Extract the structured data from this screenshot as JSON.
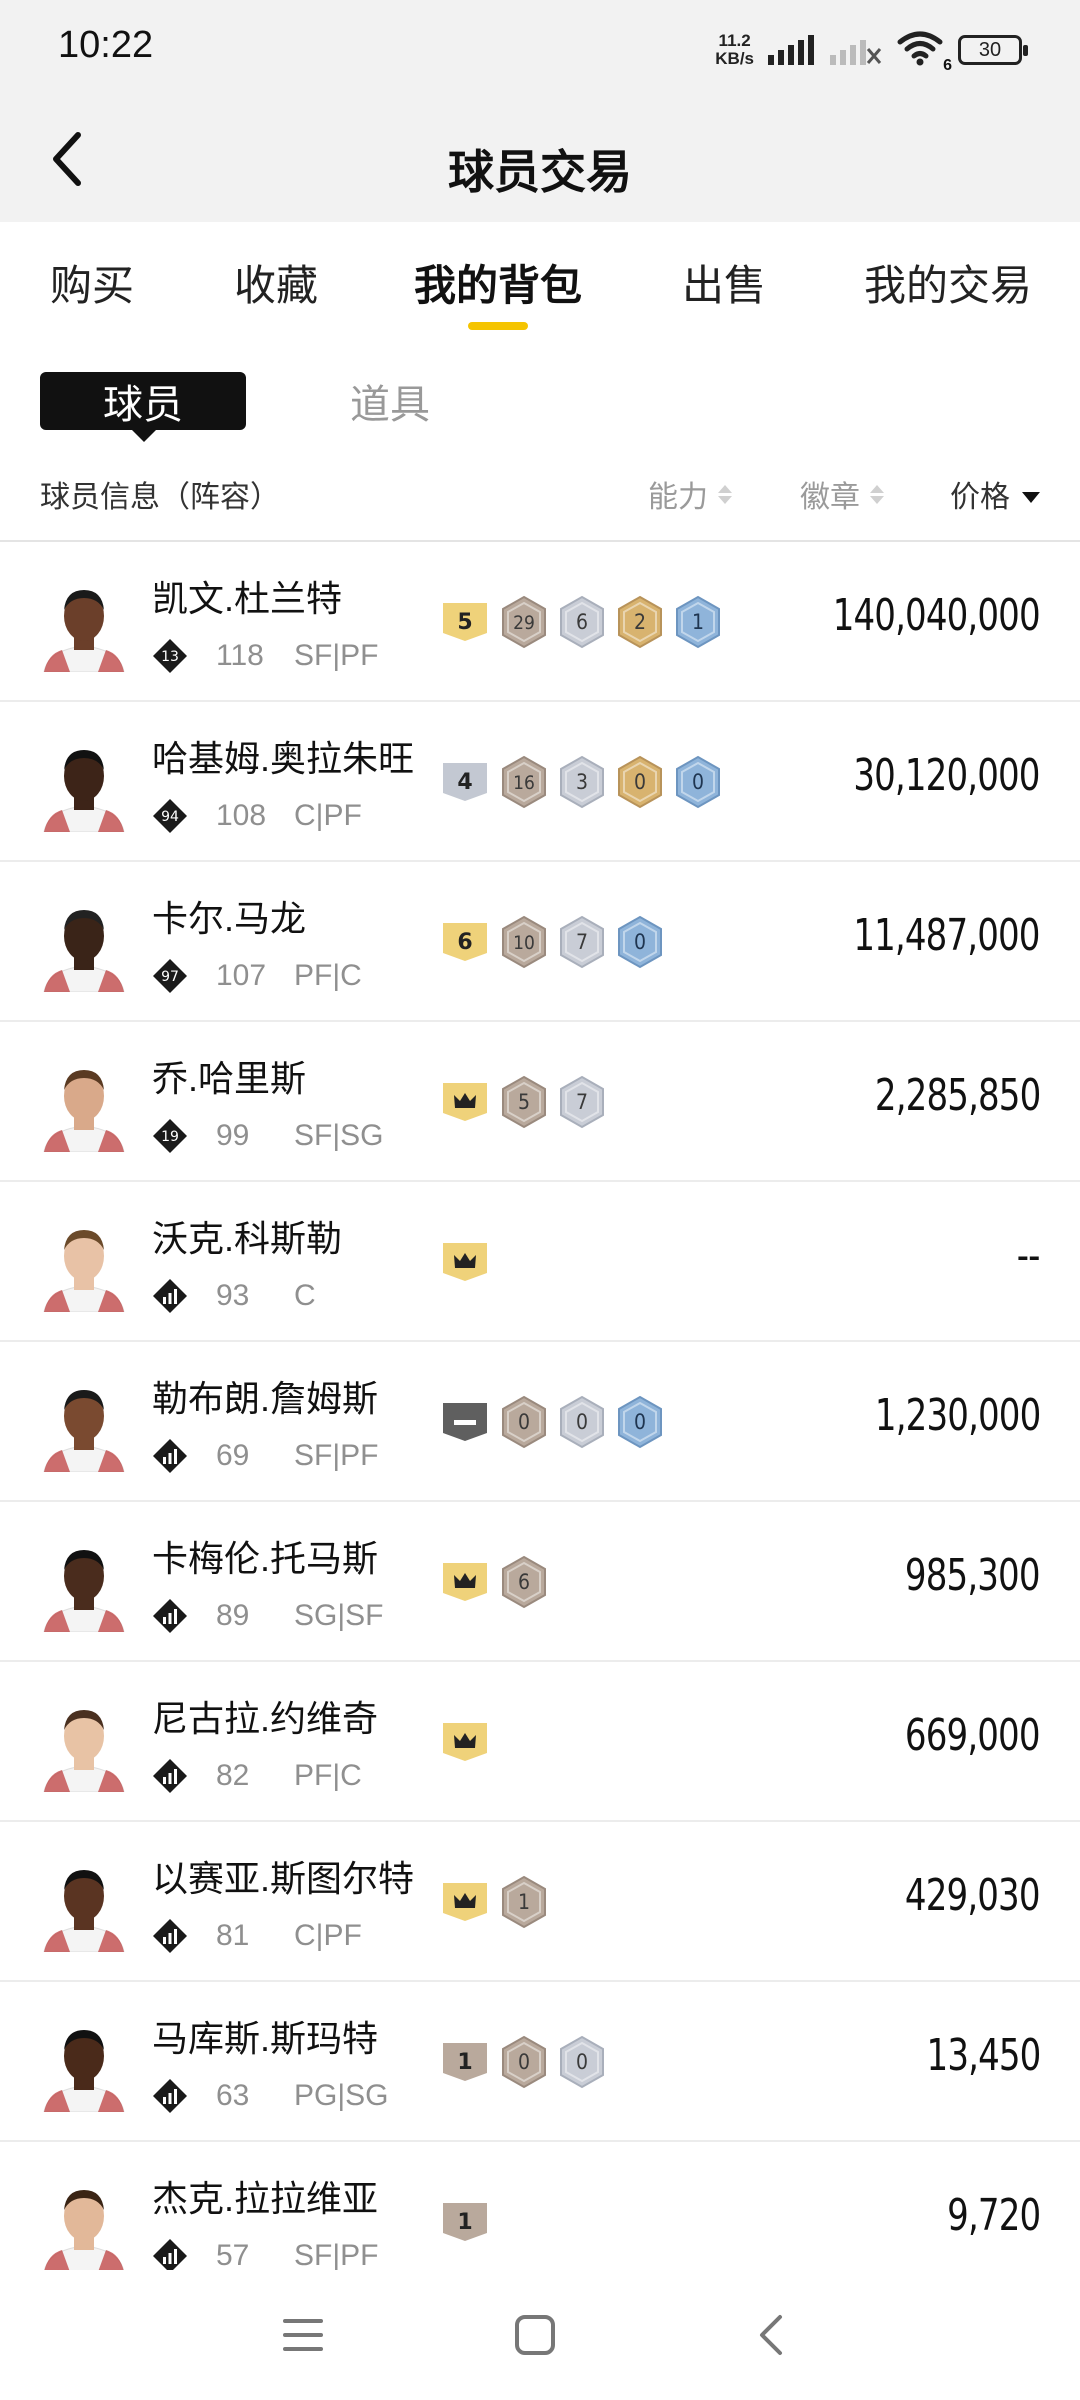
{
  "status_bar": {
    "time": "10:22",
    "net_speed_value": "11.2",
    "net_speed_unit": "KB/s",
    "battery": "30",
    "wifi_label": "6"
  },
  "header": {
    "title": "球员交易"
  },
  "main_tabs": [
    "购买",
    "收藏",
    "我的背包",
    "出售",
    "我的交易"
  ],
  "active_main_tab": 2,
  "sub_tabs": [
    "球员",
    "道具"
  ],
  "columns": {
    "info": "球员信息（阵容）",
    "ability": "能力",
    "badge": "徽章",
    "price": "价格"
  },
  "colors": {
    "accent": "#f5c400",
    "gold": "#efd27a",
    "bronze": "#b9a99c",
    "silver": "#c9cdd6",
    "hof": "#d8b36f",
    "legend": "#8fb4da",
    "dark": "#5f5f5f"
  },
  "players": [
    {
      "name": "凯文.杜兰特",
      "rank_badge": "13",
      "rank_icon": "number-diamond",
      "ovr": "118",
      "pos": "SF|PF",
      "price": "140,040,000",
      "badges": [
        {
          "kind": "gold-tag",
          "text": "5"
        },
        {
          "kind": "bronze",
          "text": "29"
        },
        {
          "kind": "silver",
          "text": "6"
        },
        {
          "kind": "gold",
          "text": "2"
        },
        {
          "kind": "legend",
          "text": "1"
        }
      ]
    },
    {
      "name": "哈基姆.奥拉朱旺",
      "rank_badge": "94",
      "rank_icon": "number-diamond",
      "ovr": "108",
      "pos": "C|PF",
      "price": "30,120,000",
      "badges": [
        {
          "kind": "silver-tag",
          "text": "4"
        },
        {
          "kind": "bronze",
          "text": "16"
        },
        {
          "kind": "silver",
          "text": "3"
        },
        {
          "kind": "gold",
          "text": "0"
        },
        {
          "kind": "legend",
          "text": "0"
        }
      ]
    },
    {
      "name": "卡尔.马龙",
      "rank_badge": "97",
      "rank_icon": "number-diamond",
      "ovr": "107",
      "pos": "PF|C",
      "price": "11,487,000",
      "badges": [
        {
          "kind": "gold-tag",
          "text": "6"
        },
        {
          "kind": "bronze",
          "text": "10"
        },
        {
          "kind": "silver",
          "text": "7"
        },
        {
          "kind": "legend",
          "text": "0"
        }
      ]
    },
    {
      "name": "乔.哈里斯",
      "rank_badge": "19",
      "rank_icon": "number-diamond",
      "ovr": "99",
      "pos": "SF|SG",
      "price": "2,285,850",
      "badges": [
        {
          "kind": "crown-tag",
          "text": ""
        },
        {
          "kind": "bronze",
          "text": "5"
        },
        {
          "kind": "silver",
          "text": "7"
        }
      ]
    },
    {
      "name": "沃克.科斯勒",
      "rank_badge": "",
      "rank_icon": "bars-diamond",
      "ovr": "93",
      "pos": "C",
      "price": "--",
      "badges": [
        {
          "kind": "crown-tag",
          "text": ""
        }
      ]
    },
    {
      "name": "勒布朗.詹姆斯",
      "rank_badge": "",
      "rank_icon": "bars-diamond",
      "ovr": "69",
      "pos": "SF|PF",
      "price": "1,230,000",
      "badges": [
        {
          "kind": "dark-tag",
          "text": ""
        },
        {
          "kind": "bronze",
          "text": "0"
        },
        {
          "kind": "silver",
          "text": "0"
        },
        {
          "kind": "legend",
          "text": "0"
        }
      ]
    },
    {
      "name": "卡梅伦.托马斯",
      "rank_badge": "",
      "rank_icon": "bars-diamond",
      "ovr": "89",
      "pos": "SG|SF",
      "price": "985,300",
      "badges": [
        {
          "kind": "crown-tag",
          "text": ""
        },
        {
          "kind": "bronze",
          "text": "6"
        }
      ]
    },
    {
      "name": "尼古拉.约维奇",
      "rank_badge": "",
      "rank_icon": "bars-diamond",
      "ovr": "82",
      "pos": "PF|C",
      "price": "669,000",
      "badges": [
        {
          "kind": "crown-tag",
          "text": ""
        }
      ]
    },
    {
      "name": "以赛亚.斯图尔特",
      "rank_badge": "",
      "rank_icon": "bars-diamond",
      "ovr": "81",
      "pos": "C|PF",
      "price": "429,030",
      "badges": [
        {
          "kind": "crown-tag",
          "text": ""
        },
        {
          "kind": "bronze",
          "text": "1"
        }
      ]
    },
    {
      "name": "马库斯.斯玛特",
      "rank_badge": "",
      "rank_icon": "bars-diamond",
      "ovr": "63",
      "pos": "PG|SG",
      "price": "13,450",
      "badges": [
        {
          "kind": "bronze-tag",
          "text": "1"
        },
        {
          "kind": "bronze",
          "text": "0"
        },
        {
          "kind": "silver",
          "text": "0"
        }
      ]
    },
    {
      "name": "杰克.拉拉维亚",
      "rank_badge": "",
      "rank_icon": "bars-diamond",
      "ovr": "57",
      "pos": "SF|PF",
      "price": "9,720",
      "badges": [
        {
          "kind": "bronze-tag",
          "text": "1"
        }
      ]
    }
  ],
  "nav": {
    "icons": [
      "menu-icon",
      "home-square-icon",
      "back-chevron-icon"
    ]
  }
}
